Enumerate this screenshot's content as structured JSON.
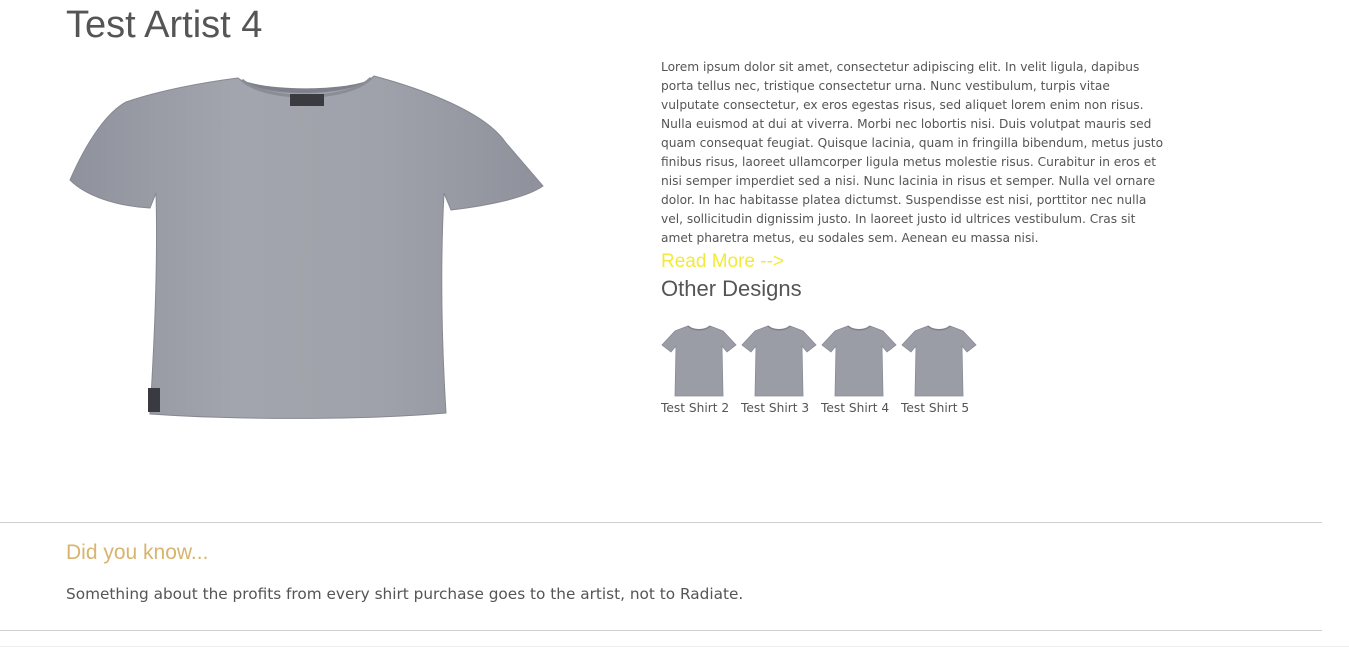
{
  "artist": {
    "name": "Test Artist 4",
    "main_image_alt": "Grey t-shirt",
    "description": "Lorem ipsum dolor sit amet, consectetur adipiscing elit. In velit ligula, dapibus porta tellus nec, tristique consectetur urna. Nunc vestibulum, turpis vitae vulputate consectetur, ex eros egestas risus, sed aliquet lorem enim non risus. Nulla euismod at dui at viverra. Morbi nec lobortis nisi. Duis volutpat mauris sed quam consequat feugiat. Quisque lacinia, quam in fringilla bibendum, metus justo finibus risus, laoreet ullamcorper ligula metus molestie risus. Curabitur in eros et nisi semper imperdiet sed a nisi. Nunc lacinia in risus et semper. Nulla vel ornare dolor. In hac habitasse platea dictumst. Suspendisse est nisi, porttitor nec nulla vel, sollicitudin dignissim justo. In laoreet justo id ultrices vestibulum. Cras sit amet pharetra metus, eu sodales sem. Aenean eu massa nisi.",
    "read_more": "Read More -->"
  },
  "other_designs": {
    "title": "Other Designs",
    "items": [
      {
        "label": "Test Shirt 2"
      },
      {
        "label": "Test Shirt 3"
      },
      {
        "label": "Test Shirt 4"
      },
      {
        "label": "Test Shirt 5"
      }
    ]
  },
  "did_you_know": {
    "title": "Did you know...",
    "text": "Something about the profits from every shirt purchase goes to the artist, not to Radiate."
  },
  "colors": {
    "shirt": "#9a9ca6",
    "read_more": "#f2ea3a",
    "did_you_know_title": "#d8b46e",
    "text": "#555555"
  }
}
